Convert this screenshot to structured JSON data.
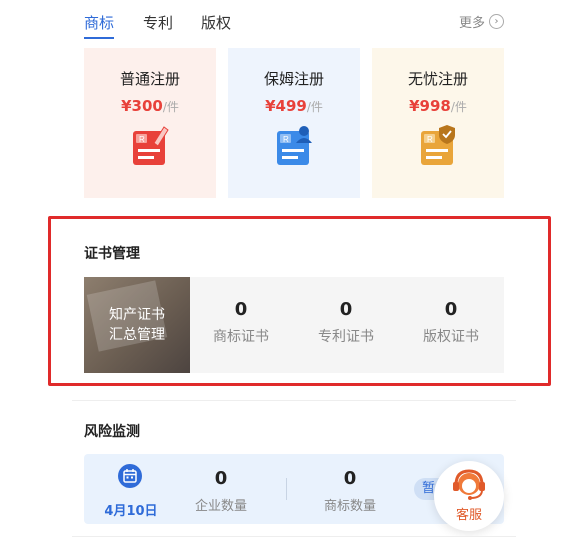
{
  "tabs": [
    {
      "label": "商标"
    },
    {
      "label": "专利"
    },
    {
      "label": "版权"
    }
  ],
  "more": {
    "label": "更多",
    "icon": "chevron-right-circle-icon"
  },
  "registration_cards": [
    {
      "title": "普通注册",
      "price": "¥300",
      "unit": "/件",
      "bg": "#fdf0ec",
      "icon": "trademark-doc-pen-icon"
    },
    {
      "title": "保姆注册",
      "price": "¥499",
      "unit": "/件",
      "bg": "#eef4fd",
      "icon": "trademark-doc-person-icon"
    },
    {
      "title": "无忧注册",
      "price": "¥998",
      "unit": "/件",
      "bg": "#fdf7ea",
      "icon": "trademark-doc-shield-icon"
    }
  ],
  "certificate": {
    "title": "证书管理",
    "banner_line1": "知产证书",
    "banner_line2": "汇总管理",
    "stats": [
      {
        "value": "0",
        "label": "商标证书"
      },
      {
        "value": "0",
        "label": "专利证书"
      },
      {
        "value": "0",
        "label": "版权证书"
      }
    ]
  },
  "risk": {
    "title": "风险监测",
    "date": "4月10日",
    "stats": [
      {
        "value": "0",
        "label": "企业数量"
      },
      {
        "value": "0",
        "label": "商标数量"
      }
    ],
    "tag": "暂"
  },
  "customer_service": {
    "label": "客服",
    "icon": "headset-agent-icon"
  },
  "colors": {
    "accent": "#2f6bd8",
    "price": "#e8413a",
    "highlight_frame": "#e02a2a"
  }
}
